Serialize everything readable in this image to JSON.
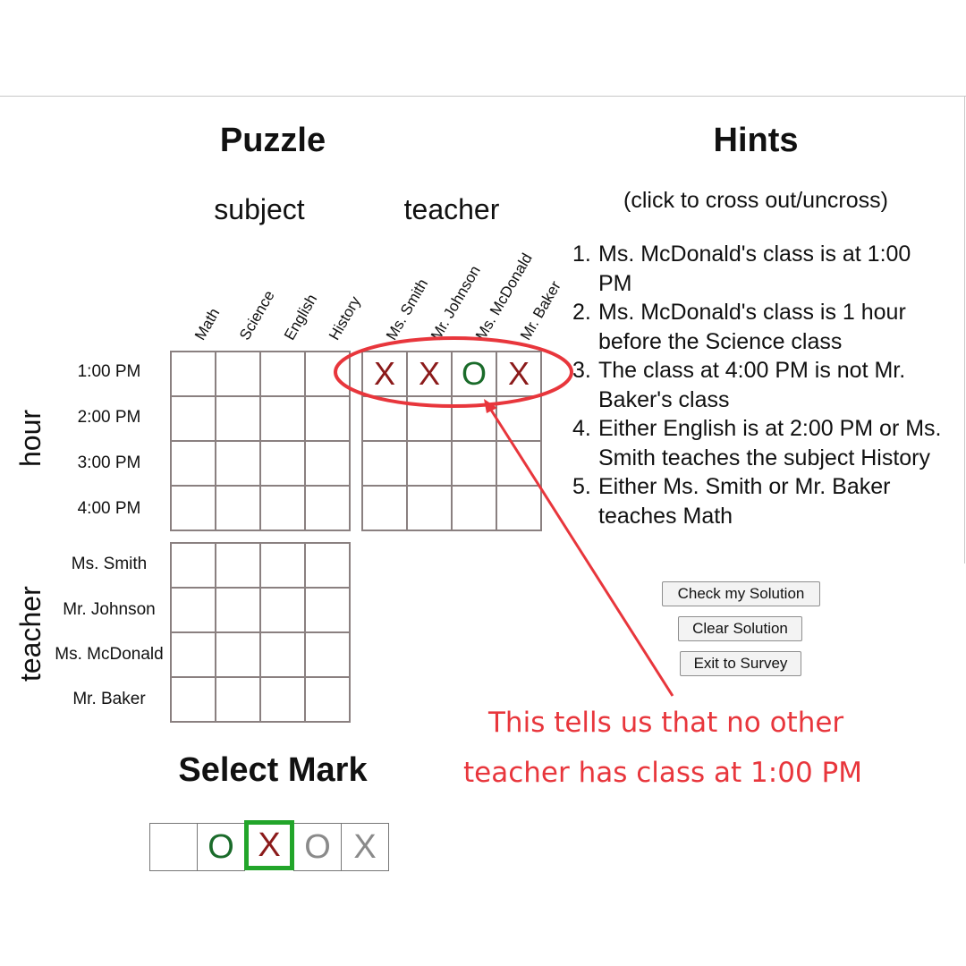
{
  "puzzle": {
    "title": "Puzzle",
    "subject_group": "subject",
    "teacher_group": "teacher",
    "hour_group": "hour",
    "teacher_row_group": "teacher",
    "subjects": [
      "Math",
      "Science",
      "English",
      "History"
    ],
    "teachers": [
      "Ms. Smith",
      "Mr. Johnson",
      "Ms. McDonald",
      "Mr. Baker"
    ],
    "hours": [
      "1:00 PM",
      "2:00 PM",
      "3:00 PM",
      "4:00 PM"
    ],
    "hour_teacher_first_row": [
      "X",
      "X",
      "O",
      "X"
    ]
  },
  "hints": {
    "title": "Hints",
    "subtitle": "(click to cross out/uncross)",
    "items": [
      {
        "num": "1.",
        "text": "Ms. McDonald's class is at 1:00 PM"
      },
      {
        "num": "2.",
        "text": "Ms. McDonald's class is 1 hour before the Science class"
      },
      {
        "num": "3.",
        "text": "The class at 4:00 PM is not Mr. Baker's class"
      },
      {
        "num": "4.",
        "text": "Either English is at 2:00 PM or Ms. Smith teaches the subject History"
      },
      {
        "num": "5.",
        "text": "Either Ms. Smith or Mr. Baker teaches Math"
      }
    ]
  },
  "buttons": {
    "check": "Check my Solution",
    "clear": "Clear Solution",
    "exit": "Exit to Survey"
  },
  "select_mark": {
    "title": "Select Mark",
    "options": [
      "",
      "O",
      "X",
      "O",
      "X"
    ],
    "selected_index": 2
  },
  "annotation": {
    "line1": "This tells us that no other",
    "line2": "teacher has class at 1:00 PM",
    "color": "#e8363c"
  },
  "colors": {
    "x_mark": "#8b1a1a",
    "o_mark": "#1a6b2a",
    "selected_border": "#22a52a"
  }
}
